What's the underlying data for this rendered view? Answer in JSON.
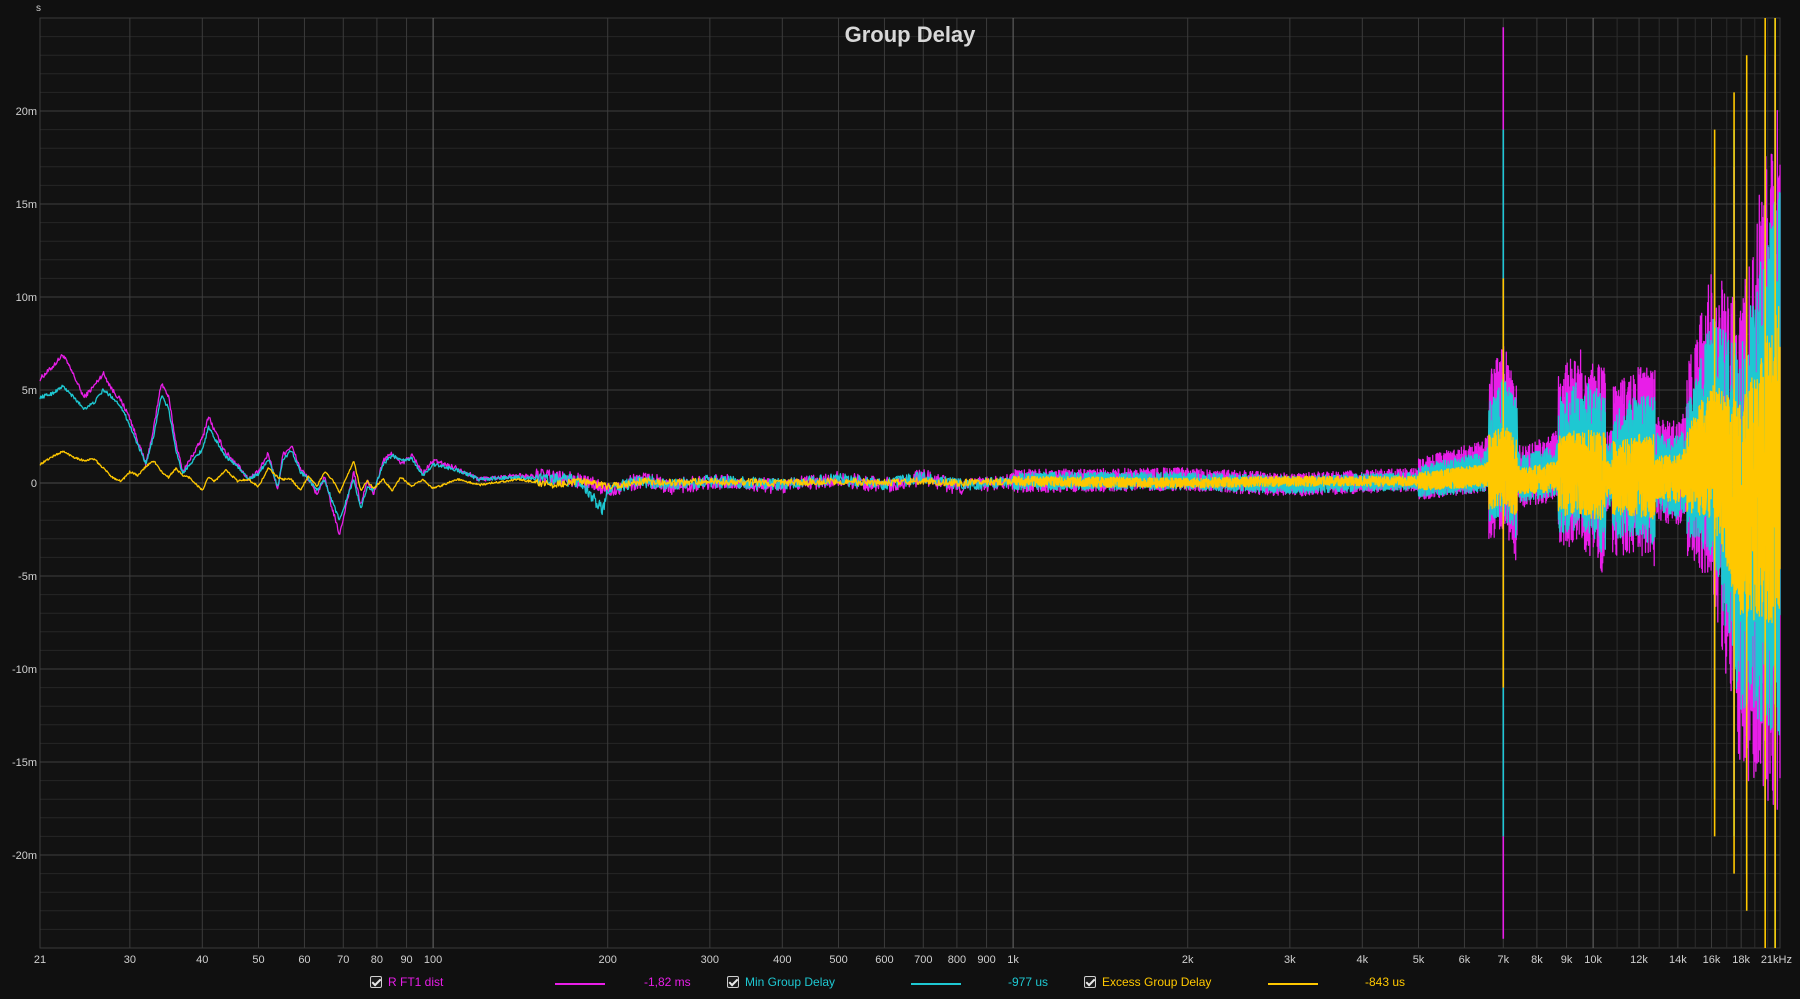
{
  "chart_data": {
    "type": "line",
    "title": "Group Delay",
    "y_unit_label": "s",
    "xscale": "log",
    "xlim": [
      21,
      21000
    ],
    "ylim": [
      -0.025,
      0.025
    ],
    "grid": true,
    "x_ticks": [
      {
        "v": 21,
        "label": "21"
      },
      {
        "v": 30,
        "label": "30"
      },
      {
        "v": 40,
        "label": "40"
      },
      {
        "v": 50,
        "label": "50"
      },
      {
        "v": 60,
        "label": "60"
      },
      {
        "v": 70,
        "label": "70"
      },
      {
        "v": 80,
        "label": "80"
      },
      {
        "v": 90,
        "label": "90"
      },
      {
        "v": 100,
        "label": "100"
      },
      {
        "v": 200,
        "label": "200"
      },
      {
        "v": 300,
        "label": "300"
      },
      {
        "v": 400,
        "label": "400"
      },
      {
        "v": 500,
        "label": "500"
      },
      {
        "v": 600,
        "label": "600"
      },
      {
        "v": 700,
        "label": "700"
      },
      {
        "v": 800,
        "label": "800"
      },
      {
        "v": 900,
        "label": "900"
      },
      {
        "v": 1000,
        "label": "1k"
      },
      {
        "v": 2000,
        "label": "2k"
      },
      {
        "v": 3000,
        "label": "3k"
      },
      {
        "v": 4000,
        "label": "4k"
      },
      {
        "v": 5000,
        "label": "5k"
      },
      {
        "v": 6000,
        "label": "6k"
      },
      {
        "v": 7000,
        "label": "7k"
      },
      {
        "v": 8000,
        "label": "8k"
      },
      {
        "v": 9000,
        "label": "9k"
      },
      {
        "v": 10000,
        "label": "10k"
      },
      {
        "v": 12000,
        "label": "12k"
      },
      {
        "v": 14000,
        "label": "14k"
      },
      {
        "v": 16000,
        "label": "16k"
      },
      {
        "v": 18000,
        "label": "18k"
      },
      {
        "v": 21000,
        "label": "21kHz"
      }
    ],
    "y_ticks": [
      {
        "v": 0.02,
        "label": "20m"
      },
      {
        "v": 0.015,
        "label": "15m"
      },
      {
        "v": 0.01,
        "label": "10m"
      },
      {
        "v": 0.005,
        "label": "5m"
      },
      {
        "v": 0,
        "label": "0"
      },
      {
        "v": -0.005,
        "label": "-5m"
      },
      {
        "v": -0.01,
        "label": "-10m"
      },
      {
        "v": -0.015,
        "label": "-15m"
      },
      {
        "v": -0.02,
        "label": "-20m"
      }
    ],
    "series": [
      {
        "name": "R FT1 dist",
        "color": "#e81ee8",
        "cursor_value": "-1,82 ms",
        "points": [
          [
            21,
            0.0056
          ],
          [
            22,
            0.0062
          ],
          [
            23,
            0.0069
          ],
          [
            24,
            0.0058
          ],
          [
            25,
            0.0046
          ],
          [
            26,
            0.0052
          ],
          [
            27,
            0.0059
          ],
          [
            28,
            0.005
          ],
          [
            29,
            0.0044
          ],
          [
            30,
            0.0035
          ],
          [
            31,
            0.0022
          ],
          [
            32,
            0.001
          ],
          [
            33,
            0.003
          ],
          [
            34,
            0.0054
          ],
          [
            35,
            0.0046
          ],
          [
            36,
            0.0022
          ],
          [
            37,
            0.0006
          ],
          [
            38,
            0.0012
          ],
          [
            40,
            0.0024
          ],
          [
            41,
            0.0036
          ],
          [
            42,
            0.0028
          ],
          [
            44,
            0.0016
          ],
          [
            46,
            0.001
          ],
          [
            48,
            0.0002
          ],
          [
            50,
            0.0006
          ],
          [
            52,
            0.0016
          ],
          [
            54,
            -0.0004
          ],
          [
            55,
            0.0015
          ],
          [
            57,
            0.002
          ],
          [
            59,
            0.0008
          ],
          [
            61,
            0.0002
          ],
          [
            63,
            -0.0006
          ],
          [
            65,
            0.0003
          ],
          [
            67,
            -0.0014
          ],
          [
            69,
            -0.0028
          ],
          [
            71,
            -0.001
          ],
          [
            73,
            0.0006
          ],
          [
            75,
            -0.0012
          ],
          [
            77,
            0.0001
          ],
          [
            79,
            -0.0006
          ],
          [
            82,
            0.0012
          ],
          [
            85,
            0.0016
          ],
          [
            88,
            0.001
          ],
          [
            92,
            0.0015
          ],
          [
            96,
            0.0005
          ],
          [
            100,
            0.0012
          ],
          [
            110,
            0.0008
          ],
          [
            120,
            0.0002
          ],
          [
            140,
            0.0004
          ],
          [
            160,
            0.0003
          ],
          [
            180,
            0.0001
          ],
          [
            200,
            -0.0004
          ],
          [
            230,
            0.0002
          ],
          [
            260,
            -0.0002
          ],
          [
            300,
            0.0001
          ],
          [
            400,
            -0.0002
          ],
          [
            500,
            0.0002
          ],
          [
            600,
            -0.0001
          ],
          [
            700,
            0.0003
          ],
          [
            800,
            -0.0002
          ],
          [
            1000,
            0.0001
          ],
          [
            2000,
            0.0002
          ],
          [
            3000,
            -0.0001
          ],
          [
            5000,
            0.0002
          ],
          [
            6500,
            0.0009
          ],
          [
            7000,
            0.0025
          ],
          [
            7500,
            0.0003
          ],
          [
            8500,
            0.0008
          ],
          [
            9500,
            0.002
          ],
          [
            10500,
            0.0005
          ],
          [
            12000,
            0.0012
          ],
          [
            14000,
            0.0004
          ],
          [
            16000,
            0.003
          ],
          [
            18000,
            -0.003
          ],
          [
            21000,
            0.002
          ]
        ]
      },
      {
        "name": "Min Group Delay",
        "color": "#1ec8d2",
        "cursor_value": "-977 us",
        "points": [
          [
            21,
            0.0046
          ],
          [
            22,
            0.0048
          ],
          [
            23,
            0.0052
          ],
          [
            24,
            0.0046
          ],
          [
            25,
            0.004
          ],
          [
            26,
            0.0043
          ],
          [
            27,
            0.005
          ],
          [
            28,
            0.0046
          ],
          [
            29,
            0.0041
          ],
          [
            30,
            0.0031
          ],
          [
            31,
            0.002
          ],
          [
            32,
            0.001
          ],
          [
            33,
            0.0026
          ],
          [
            34,
            0.0047
          ],
          [
            35,
            0.004
          ],
          [
            36,
            0.0018
          ],
          [
            37,
            0.0005
          ],
          [
            38,
            0.001
          ],
          [
            40,
            0.0018
          ],
          [
            41,
            0.003
          ],
          [
            42,
            0.0024
          ],
          [
            44,
            0.0014
          ],
          [
            46,
            0.0009
          ],
          [
            48,
            0.0002
          ],
          [
            50,
            0.0005
          ],
          [
            52,
            0.0013
          ],
          [
            54,
            -0.0002
          ],
          [
            55,
            0.0012
          ],
          [
            57,
            0.0018
          ],
          [
            59,
            0.0006
          ],
          [
            61,
            0.0002
          ],
          [
            63,
            -0.0004
          ],
          [
            65,
            0.0002
          ],
          [
            67,
            -0.001
          ],
          [
            69,
            -0.002
          ],
          [
            71,
            -0.0008
          ],
          [
            73,
            0.0002
          ],
          [
            75,
            -0.0014
          ],
          [
            77,
            -0.0002
          ],
          [
            79,
            -0.0004
          ],
          [
            82,
            0.001
          ],
          [
            85,
            0.0015
          ],
          [
            88,
            0.0012
          ],
          [
            92,
            0.0013
          ],
          [
            96,
            0.0004
          ],
          [
            100,
            0.001
          ],
          [
            110,
            0.0007
          ],
          [
            120,
            0.0002
          ],
          [
            140,
            0.0003
          ],
          [
            160,
            0.0002
          ],
          [
            180,
            0.0001
          ],
          [
            196,
            -0.0015
          ],
          [
            200,
            -0.0003
          ],
          [
            230,
            0.0001
          ],
          [
            260,
            -0.0001
          ],
          [
            300,
            0.0001
          ],
          [
            400,
            -0.0001
          ],
          [
            500,
            0.0002
          ],
          [
            600,
            -0.0001
          ],
          [
            700,
            0.0003
          ],
          [
            800,
            -0.0001
          ],
          [
            1000,
            0.0001
          ],
          [
            2000,
            0.0001
          ],
          [
            3000,
            -0.0001
          ],
          [
            5000,
            0.0001
          ],
          [
            6500,
            0.0006
          ],
          [
            7000,
            0.002
          ],
          [
            7500,
            0.0002
          ],
          [
            8500,
            0.0006
          ],
          [
            9500,
            0.0016
          ],
          [
            10500,
            0.0004
          ],
          [
            12000,
            0.0009
          ],
          [
            14000,
            0.0003
          ],
          [
            16000,
            0.0025
          ],
          [
            18000,
            -0.0025
          ],
          [
            21000,
            0.0015
          ]
        ]
      },
      {
        "name": "Excess Group Delay",
        "color": "#ffc800",
        "cursor_value": "-843 us",
        "points": [
          [
            21,
            0.001
          ],
          [
            22,
            0.0014
          ],
          [
            23,
            0.0017
          ],
          [
            24,
            0.0014
          ],
          [
            25,
            0.0012
          ],
          [
            26,
            0.0013
          ],
          [
            27,
            0.0008
          ],
          [
            28,
            0.0003
          ],
          [
            29,
            0.0001
          ],
          [
            30,
            0.0006
          ],
          [
            31,
            0.0004
          ],
          [
            32,
            0.0009
          ],
          [
            33,
            0.0012
          ],
          [
            34,
            0.0006
          ],
          [
            35,
            0.0003
          ],
          [
            36,
            0.0008
          ],
          [
            37,
            0.0004
          ],
          [
            38,
            0.0003
          ],
          [
            40,
            -0.0004
          ],
          [
            41,
            0.0003
          ],
          [
            42,
            0.0001
          ],
          [
            44,
            0.0007
          ],
          [
            46,
            0.0001
          ],
          [
            48,
            0.0002
          ],
          [
            50,
            -0.0002
          ],
          [
            52,
            0.0008
          ],
          [
            54,
            0.0003
          ],
          [
            55,
            0.0002
          ],
          [
            57,
            0.0002
          ],
          [
            59,
            -0.0004
          ],
          [
            61,
            0.0004
          ],
          [
            63,
            -0.0002
          ],
          [
            65,
            0.0006
          ],
          [
            67,
            0.0002
          ],
          [
            69,
            -0.0005
          ],
          [
            71,
            0.0003
          ],
          [
            73,
            0.0012
          ],
          [
            75,
            -0.0004
          ],
          [
            77,
            0.0001
          ],
          [
            79,
            -0.0003
          ],
          [
            82,
            0.0002
          ],
          [
            85,
            -0.0004
          ],
          [
            88,
            0.0003
          ],
          [
            92,
            -0.0002
          ],
          [
            96,
            0.0002
          ],
          [
            100,
            -0.0003
          ],
          [
            110,
            0.0002
          ],
          [
            120,
            -0.0001
          ],
          [
            140,
            0.0002
          ],
          [
            160,
            -0.0001
          ],
          [
            180,
            0.0001
          ],
          [
            200,
            -0.0002
          ],
          [
            230,
            0.0001
          ],
          [
            260,
            0.0
          ],
          [
            300,
            0.0001
          ],
          [
            400,
            0.0
          ],
          [
            500,
            0.0001
          ],
          [
            600,
            0.0
          ],
          [
            700,
            0.0001
          ],
          [
            800,
            0.0
          ],
          [
            1000,
            0.0001
          ],
          [
            2000,
            0.0
          ],
          [
            3000,
            0.0001
          ],
          [
            5000,
            0.0001
          ],
          [
            6500,
            0.0004
          ],
          [
            7000,
            0.001
          ],
          [
            7500,
            0.0001
          ],
          [
            8500,
            0.0003
          ],
          [
            9500,
            0.0006
          ],
          [
            10500,
            0.0002
          ],
          [
            12000,
            0.0004
          ],
          [
            14000,
            0.0002
          ],
          [
            16000,
            0.0018
          ],
          [
            18000,
            -0.0015
          ],
          [
            21000,
            0.001
          ]
        ]
      }
    ]
  }
}
